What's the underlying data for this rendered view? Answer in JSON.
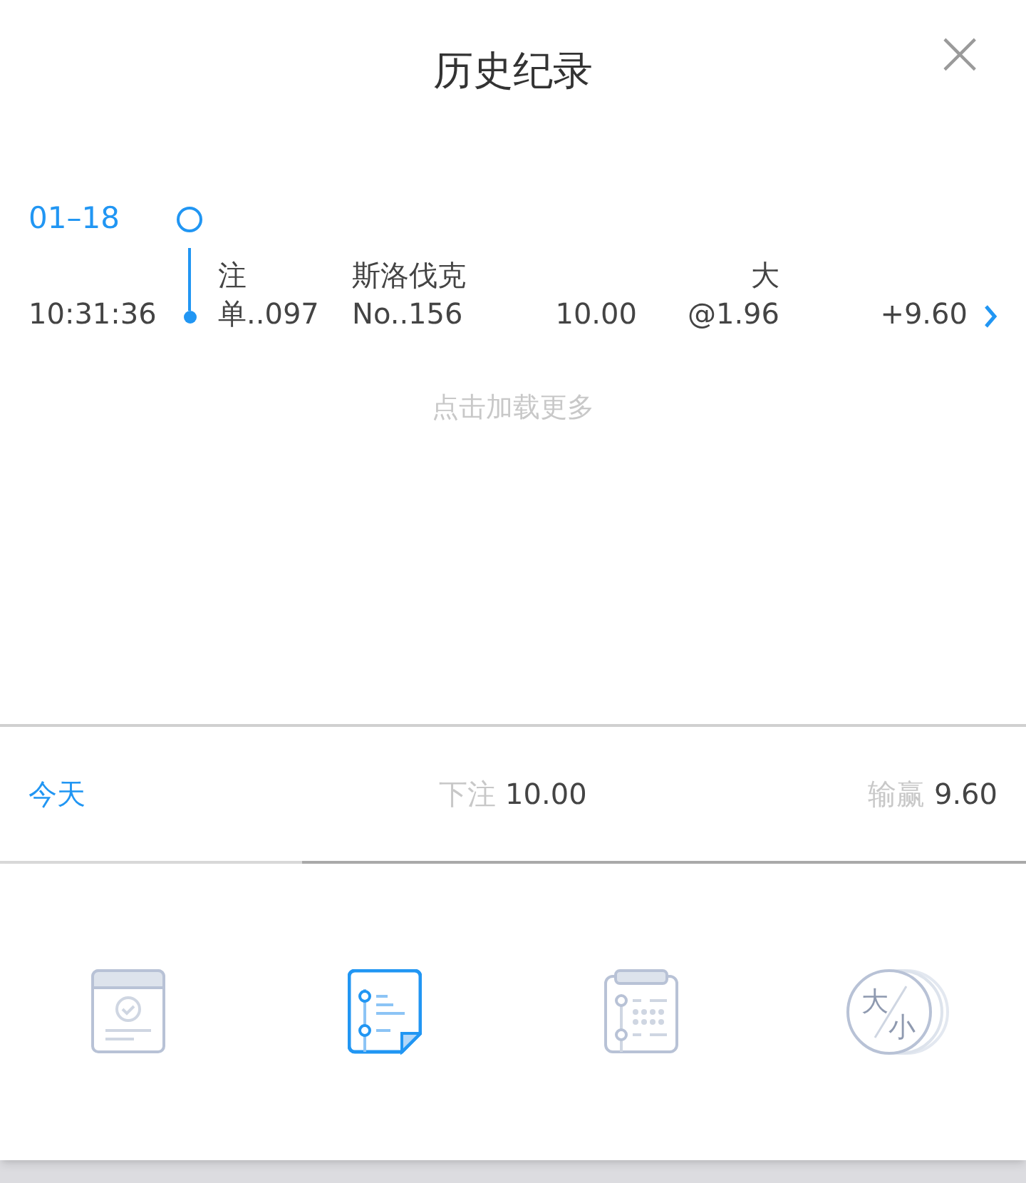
{
  "header": {
    "title": "历史纪录",
    "close": "×"
  },
  "groups": [
    {
      "date": "01–18",
      "records": [
        {
          "time": "10:31:36",
          "order_lines": [
            "注",
            "单..097"
          ],
          "league": "斯洛伐克",
          "match": "No..156",
          "stake": "10.00",
          "pick": "大",
          "odds": "@1.96",
          "result": "+9.60"
        }
      ]
    }
  ],
  "load_more": "点击加载更多",
  "summary": {
    "period": "今天",
    "bet_label": "下注",
    "bet_value": "10.00",
    "win_label": "输赢",
    "win_value": "9.60"
  },
  "tabs": [
    {
      "kind": "calendar",
      "selected": false
    },
    {
      "kind": "list",
      "selected": true
    },
    {
      "kind": "clipboard",
      "selected": false
    },
    {
      "kind": "coins",
      "selected": false,
      "glyph_top": "大",
      "glyph_bottom": "小"
    }
  ]
}
